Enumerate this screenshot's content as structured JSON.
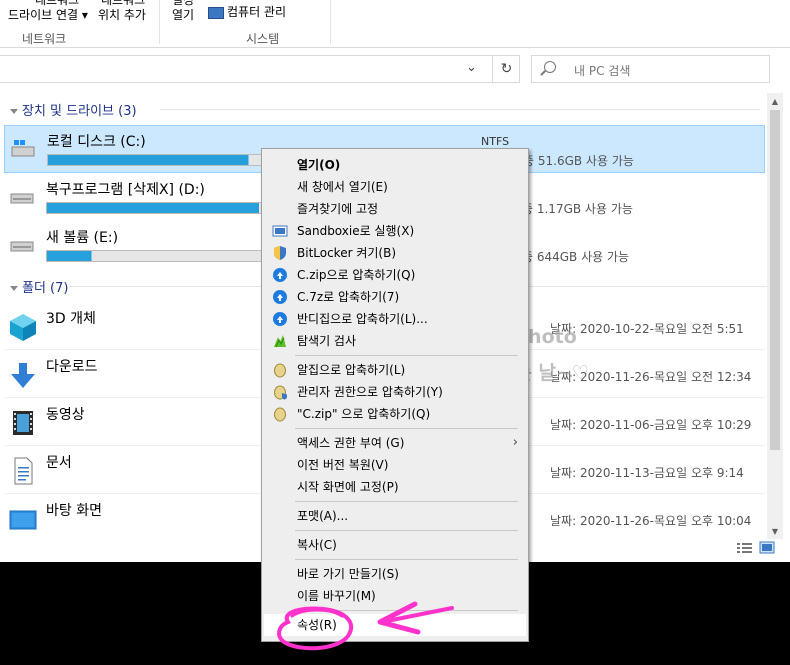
{
  "ribbon": {
    "network_group": {
      "item1_line1": "네트워크",
      "item1_line2": "드라이브 연결 ▾",
      "item2_line1": "네트워크",
      "item2_line2": "위치 추가",
      "label": "네트워크"
    },
    "system_group": {
      "open_settings_line1": "설정",
      "open_settings_line2": "열기",
      "computer_manage": "컴퓨터 관리",
      "label": "시스템"
    }
  },
  "search": {
    "placeholder": "내 PC 검색"
  },
  "sections": {
    "drives": "장치 및 드라이브 (3)",
    "folders": "폴더 (7)"
  },
  "drives": [
    {
      "name": "로컬 디스크 (C:)",
      "fs": "NTFS",
      "free": "중 51.6GB 사용 가능",
      "used_fraction": 0.9
    },
    {
      "name": "복구프로그램 [삭제X] (D:)",
      "fs": "",
      "free": "중 1.17GB 사용 가능",
      "used_fraction": 0.95
    },
    {
      "name": "새 볼륨 (E:)",
      "fs": "",
      "free": "중 644GB 사용 가능",
      "used_fraction": 0.2
    }
  ],
  "folders": [
    {
      "name": "3D 개체",
      "date": "날짜: 2020-10-22-목요일 오전 5:51",
      "icon": "3d-objects-icon"
    },
    {
      "name": "다운로드",
      "date": "날짜: 2020-11-26-목요일 오전 12:34",
      "icon": "download-icon"
    },
    {
      "name": "동영상",
      "date": "날짜: 2020-11-06-금요일 오후 10:29",
      "icon": "video-icon"
    },
    {
      "name": "문서",
      "date": "날짜: 2020-11-13-금요일 오후 9:14",
      "icon": "document-icon"
    },
    {
      "name": "바탕 화면",
      "date": "날짜: 2020-11-26-목요일 오후 10:04",
      "icon": "desktop-icon"
    }
  ],
  "context_menu": {
    "open": "열기(O)",
    "open_new_window": "새 창에서 열기(E)",
    "pin_quick": "즐겨찾기에 고정",
    "sandboxie": "Sandboxie로 실행(X)",
    "bitlocker": "BitLocker 켜기(B)",
    "zip": "C.zip으로 압축하기(Q)",
    "sevenz": "C.7z로 압축하기(7)",
    "bandizip": "반디집으로 압축하기(L)...",
    "scan": "탐색기 검사",
    "alzip": "알집으로 압축하기(L)",
    "admin_zip": "관리자 권한으로 압축하기(Y)",
    "czip2": "\"C.zip\" 으로 압축하기(Q)",
    "access": "액세스 권한 부여 (G)",
    "restore": "이전 버전 복원(V)",
    "pin_start": "시작 화면에 고정(P)",
    "format": "포맷(A)...",
    "copy": "복사(C)",
    "shortcut": "바로 가기 만들기(S)",
    "rename": "이름 바꾸기(M)",
    "properties": "속성(R)"
  },
  "watermark": {
    "line1": "스토리photo",
    "line2": "추월이는 날~♡"
  },
  "colors": {
    "accent": "#26a0da",
    "selection": "#cce8ff",
    "section_text": "#1e3287",
    "annotation": "#ff33cc"
  }
}
